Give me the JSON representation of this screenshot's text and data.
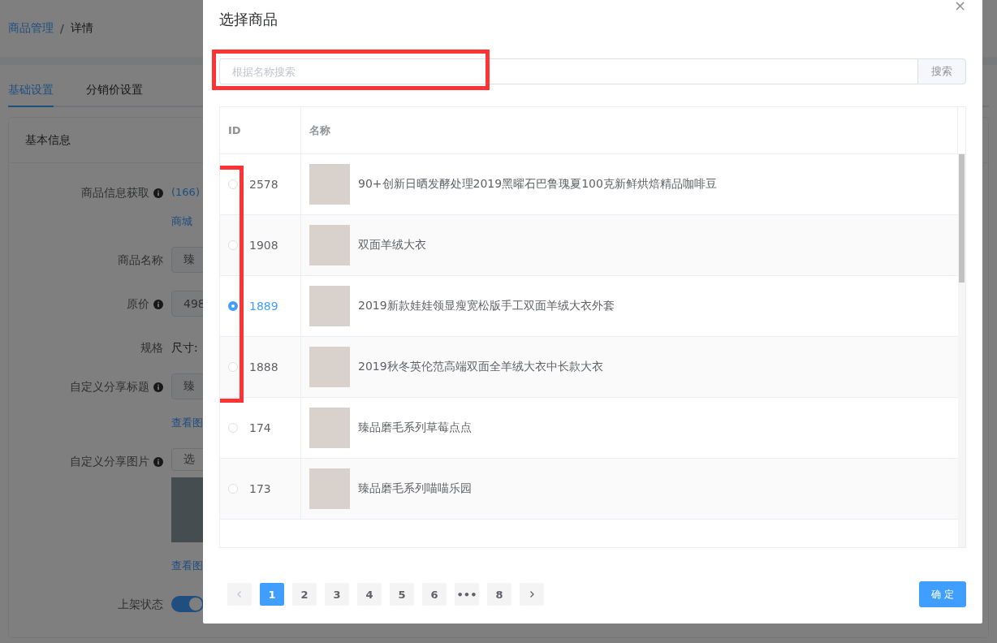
{
  "page": {
    "separator": "/",
    "breadcrumb": [
      {
        "label": "商品管理",
        "link": true
      },
      {
        "label": "详情",
        "link": false
      }
    ],
    "tabs": [
      {
        "label": "基础设置",
        "selected": true
      },
      {
        "label": "分销价设置",
        "selected": false
      }
    ],
    "card_title": "基本信息",
    "form": [
      {
        "kind": "link",
        "label": "商品信息获取",
        "info": true,
        "lines": [
          "(166)",
          "商城"
        ]
      },
      {
        "kind": "input",
        "label": "商品名称",
        "info": false,
        "value": "臻"
      },
      {
        "kind": "input",
        "label": "原价",
        "info": true,
        "value": "498"
      },
      {
        "kind": "text",
        "label": "规格",
        "info": false,
        "value": "尺寸:"
      },
      {
        "kind": "input",
        "label": "自定义分享标题",
        "info": true,
        "value": "臻",
        "link": "查看图"
      },
      {
        "kind": "image",
        "label": "自定义分享图片",
        "info": true,
        "button": "选",
        "link": "查看图"
      },
      {
        "kind": "switch",
        "label": "上架状态",
        "info": false,
        "on": true
      }
    ]
  },
  "dialog": {
    "title": "选择商品",
    "close": "×",
    "search": {
      "placeholder": "根据名称搜索",
      "button": "搜索"
    },
    "columns": [
      "ID",
      "名称"
    ],
    "rows": [
      {
        "id": "2578",
        "name": "90+创新日晒发酵处理2019黑曜石巴鲁瑰夏100克新鲜烘焙精品咖啡豆",
        "selected": false
      },
      {
        "id": "1908",
        "name": "双面羊绒大衣",
        "selected": false
      },
      {
        "id": "1889",
        "name": "2019新款娃娃领显瘦宽松版手工双面羊绒大衣外套",
        "selected": true
      },
      {
        "id": "1888",
        "name": "2019秋冬英伦范高端双面全羊绒大衣中长款大衣",
        "selected": false
      },
      {
        "id": "174",
        "name": "臻品磨毛系列草莓点点",
        "selected": false
      },
      {
        "id": "173",
        "name": "臻品磨毛系列喵喵乐园",
        "selected": false
      }
    ],
    "pagination": {
      "prev_disabled": true,
      "pages": [
        {
          "label": "1",
          "selected": true
        },
        {
          "label": "2",
          "selected": false
        },
        {
          "label": "3",
          "selected": false
        },
        {
          "label": "4",
          "selected": false
        },
        {
          "label": "5",
          "selected": false
        },
        {
          "label": "6",
          "selected": false
        },
        {
          "label": "•••",
          "selected": false
        },
        {
          "label": "8",
          "selected": false
        }
      ],
      "next_disabled": false
    },
    "confirm": "确 定"
  }
}
